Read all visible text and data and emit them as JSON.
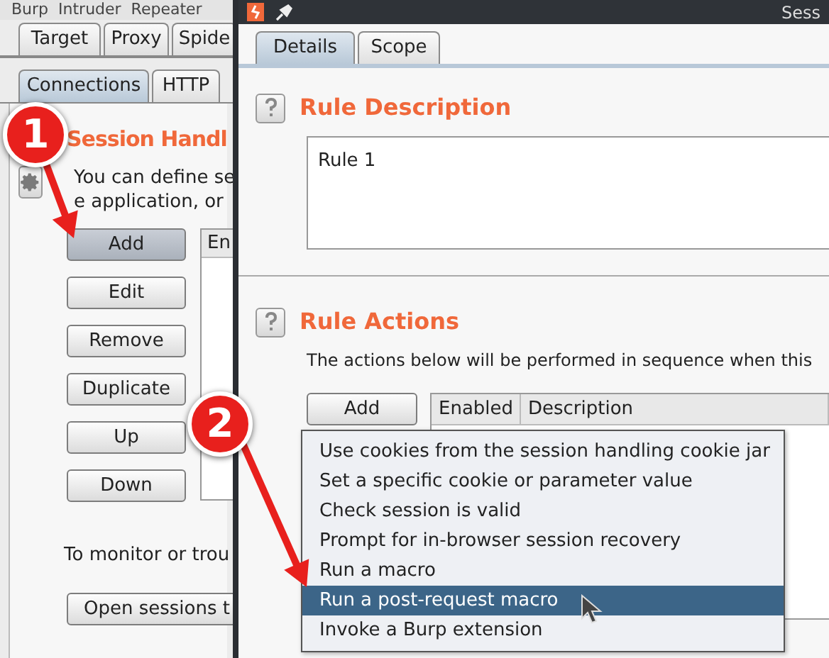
{
  "background_window": {
    "menu": "Burp  Intruder  Repeater",
    "tabs": [
      {
        "label": "Target",
        "selected": false
      },
      {
        "label": "Proxy",
        "selected": false
      },
      {
        "label": "Spide",
        "selected": false
      }
    ],
    "subtabs": [
      {
        "label": "Connections",
        "selected": true
      },
      {
        "label": "HTTP",
        "selected": false
      }
    ],
    "title": "Session Handl",
    "description": [
      "You can define se",
      "e application, or"
    ],
    "buttons": [
      {
        "label": "Add",
        "pressed": true
      },
      {
        "label": "Edit",
        "pressed": false
      },
      {
        "label": "Remove",
        "pressed": false
      },
      {
        "label": "Duplicate",
        "pressed": false
      },
      {
        "label": "Up",
        "pressed": false
      },
      {
        "label": "Down",
        "pressed": false
      }
    ],
    "table_header": "En",
    "monitor_text": "To monitor or trou",
    "open_button": "Open sessions t"
  },
  "dialog": {
    "title": "Sess",
    "tabs": [
      {
        "label": "Details",
        "selected": true
      },
      {
        "label": "Scope",
        "selected": false
      }
    ],
    "description_section": {
      "title": "Rule Description",
      "value": "Rule 1"
    },
    "actions_section": {
      "title": "Rule Actions",
      "text": "The actions below will be performed in sequence when this",
      "add_button": "Add",
      "columns": [
        "Enabled",
        "Description"
      ]
    },
    "menu": {
      "items": [
        {
          "label": "Use cookies from the session handling cookie jar",
          "selected": false
        },
        {
          "label": "Set a specific cookie or parameter value",
          "selected": false
        },
        {
          "label": "Check session is valid",
          "selected": false
        },
        {
          "label": "Prompt for in-browser session recovery",
          "selected": false
        },
        {
          "label": "Run a macro",
          "selected": false
        },
        {
          "label": "Run a post-request macro",
          "selected": true
        },
        {
          "label": "Invoke a Burp extension",
          "selected": false
        }
      ]
    }
  },
  "annotations": [
    {
      "label": "1"
    },
    {
      "label": "2"
    }
  ]
}
